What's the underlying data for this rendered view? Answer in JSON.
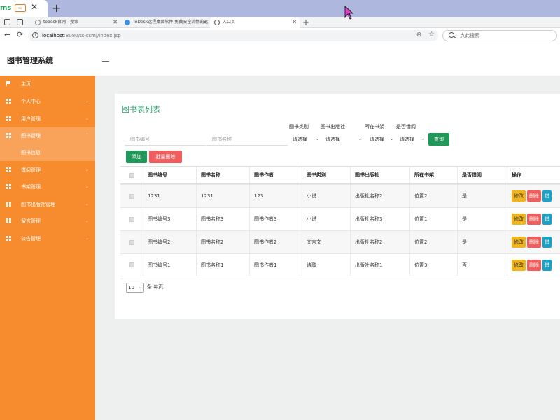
{
  "window": {
    "app_tab_text": "ms",
    "close_glyph": "✕",
    "new_glyph": "+",
    "badge_text": "▭"
  },
  "browser": {
    "tabs": [
      {
        "label": "todesk官网 - 搜索",
        "close": "✕",
        "active": false
      },
      {
        "label": "ToDesk远程桌面软件-免费安全流畅的远",
        "close": "✕",
        "active": false
      },
      {
        "label": "入口页",
        "close": "✕",
        "active": true
      }
    ],
    "new_tab": "+",
    "address": {
      "host": "localhost",
      "path": ":8080/ts-ssmj/index.jsp"
    },
    "search_placeholder": "点此搜索",
    "icons": {
      "back": "←",
      "reload": "⟳",
      "star": "☆",
      "reader": "⊖",
      "info": "i"
    }
  },
  "app": {
    "title": "图书管理系统"
  },
  "sidebar": {
    "items": [
      {
        "label": "主页",
        "icon": "flag-icon",
        "chevron": ""
      },
      {
        "label": "个人中心",
        "icon": "grid-icon",
        "chevron": "⌄"
      },
      {
        "label": "用户管理",
        "icon": "grid-icon",
        "chevron": "⌄"
      },
      {
        "label": "图书管理",
        "icon": "grid-icon",
        "chevron": "⌃"
      },
      {
        "label": "借阅管理",
        "icon": "grid-icon",
        "chevron": "⌄"
      },
      {
        "label": "书架管理",
        "icon": "grid-icon",
        "chevron": "⌄"
      },
      {
        "label": "图书出版社管理",
        "icon": "grid-icon",
        "chevron": "⌄"
      },
      {
        "label": "留言管理",
        "icon": "grid-icon",
        "chevron": "⌄"
      },
      {
        "label": "公告管理",
        "icon": "grid-icon",
        "chevron": "⌄"
      }
    ],
    "sub_item": "图书信息"
  },
  "main": {
    "card_title": "图书表列表",
    "filters": {
      "book_no_placeholder": "图书编号",
      "book_name_placeholder": "图书名称",
      "category_label": "图书类别",
      "publisher_label": "图书出版社",
      "shelf_label": "所在书架",
      "borrowed_label": "是否借阅",
      "select_default": "请选择",
      "dropdown_glyph": "⌄"
    },
    "buttons": {
      "query": "查询",
      "add": "添加",
      "batch_delete": "批量删除"
    },
    "table": {
      "headers": [
        "图书编号",
        "图书名称",
        "图书作者",
        "图书类别",
        "图书出版社",
        "所在书架",
        "是否借阅",
        "操作"
      ],
      "rows": [
        [
          "1231",
          "1231",
          "123",
          "小说",
          "出版社名称2",
          "位置2",
          "是"
        ],
        [
          "图书编号3",
          "图书名称3",
          "图书作者3",
          "小说",
          "出版社名称3",
          "位置1",
          "是"
        ],
        [
          "图书编号2",
          "图书名称2",
          "图书作者2",
          "文言文",
          "出版社名称2",
          "位置2",
          "是"
        ],
        [
          "图书编号1",
          "图书名称1",
          "图书作者1",
          "诗歌",
          "出版社名称1",
          "位置3",
          "否"
        ]
      ],
      "actions": {
        "edit": "修改",
        "delete": "删除",
        "detail": "借"
      }
    },
    "pager": {
      "page_size": "10",
      "page_size_label": "条 每页"
    }
  },
  "colors": {
    "sidebar": "#f78c2f",
    "accent_green": "#21985a",
    "danger": "#ef5d5d",
    "warning": "#f2b41c",
    "info": "#1aa2c6",
    "title_green": "#2e9b6b"
  }
}
